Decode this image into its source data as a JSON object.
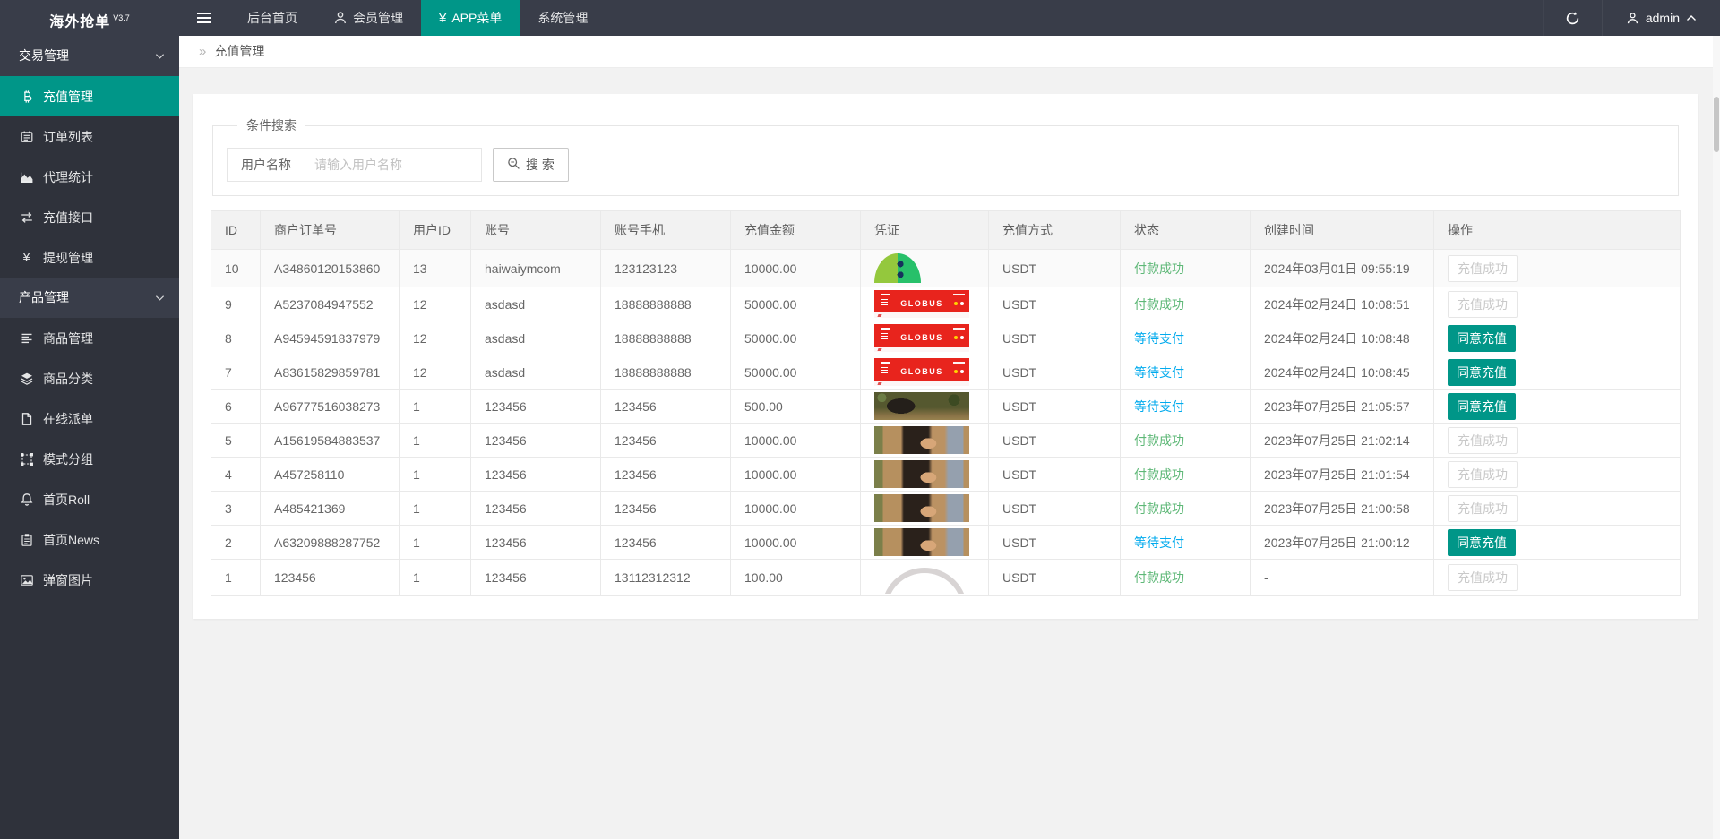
{
  "app": {
    "title": "海外抢单",
    "version": "V3.7"
  },
  "topbar": {
    "nav": [
      {
        "key": "dashboard",
        "label": "后台首页"
      },
      {
        "key": "members",
        "label": "会员管理",
        "icon": "user-icon"
      },
      {
        "key": "app-menu",
        "label": "APP菜单",
        "icon": "yen-icon",
        "active": true
      },
      {
        "key": "system",
        "label": "系统管理"
      }
    ],
    "username": "admin"
  },
  "sidebar": {
    "items": [
      {
        "type": "group",
        "key": "trade-manage",
        "label": "交易管理"
      },
      {
        "type": "item",
        "key": "recharge-manage",
        "label": "充值管理",
        "icon": "bitcoin-icon",
        "active": true
      },
      {
        "type": "item",
        "key": "order-list",
        "label": "订单列表",
        "icon": "order-list-icon"
      },
      {
        "type": "item",
        "key": "agent-stats",
        "label": "代理统计",
        "icon": "chart-area-icon"
      },
      {
        "type": "item",
        "key": "recharge-api",
        "label": "充值接口",
        "icon": "exchange-icon"
      },
      {
        "type": "item",
        "key": "withdraw-manage",
        "label": "提现管理",
        "icon": "yen-icon"
      },
      {
        "type": "group",
        "key": "product-manage",
        "label": "产品管理"
      },
      {
        "type": "item",
        "key": "goods-manage",
        "label": "商品管理",
        "icon": "list-icon"
      },
      {
        "type": "item",
        "key": "goods-category",
        "label": "商品分类",
        "icon": "layers-icon"
      },
      {
        "type": "item",
        "key": "online-dispatch",
        "label": "在线派单",
        "icon": "file-icon"
      },
      {
        "type": "item",
        "key": "mode-group",
        "label": "模式分组",
        "icon": "object-group-icon"
      },
      {
        "type": "item",
        "key": "home-roll",
        "label": "首页Roll",
        "icon": "bell-icon"
      },
      {
        "type": "item",
        "key": "home-news",
        "label": "首页News",
        "icon": "clipboard-icon"
      },
      {
        "type": "item",
        "key": "popup-image",
        "label": "弹窗图片",
        "icon": "image-icon"
      }
    ]
  },
  "breadcrumb": {
    "separator": "»",
    "label": "充值管理"
  },
  "search": {
    "legend": "条件搜索",
    "field_label": "用户名称",
    "placeholder": "请输入用户名称",
    "button_label": "搜 索"
  },
  "table": {
    "columns": [
      "ID",
      "商户订单号",
      "用户ID",
      "账号",
      "账号手机",
      "充值金额",
      "凭证",
      "充值方式",
      "状态",
      "创建时间",
      "操作"
    ],
    "status_labels": {
      "success": "付款成功",
      "pending": "等待支付"
    },
    "action_labels": {
      "disabled": "充值成功",
      "primary": "同意充值"
    },
    "voucher_text": {
      "globus": "GLOBUS"
    },
    "rows": [
      {
        "id": "10",
        "order_no": "A34860120153860",
        "user_id": "13",
        "account": "haiwaiymcom",
        "phone": "123123123",
        "amount": "10000.00",
        "voucher": "green-pie",
        "method": "USDT",
        "status": "success",
        "created": "2024年03月01日 09:55:19",
        "action": "disabled"
      },
      {
        "id": "9",
        "order_no": "A5237084947552",
        "user_id": "12",
        "account": "asdasd",
        "phone": "18888888888",
        "amount": "50000.00",
        "voucher": "globus",
        "method": "USDT",
        "status": "success",
        "created": "2024年02月24日 10:08:51",
        "action": "disabled"
      },
      {
        "id": "8",
        "order_no": "A94594591837979",
        "user_id": "12",
        "account": "asdasd",
        "phone": "18888888888",
        "amount": "50000.00",
        "voucher": "globus",
        "method": "USDT",
        "status": "pending",
        "created": "2024年02月24日 10:08:48",
        "action": "primary"
      },
      {
        "id": "7",
        "order_no": "A83615829859781",
        "user_id": "12",
        "account": "asdasd",
        "phone": "18888888888",
        "amount": "50000.00",
        "voucher": "globus",
        "method": "USDT",
        "status": "pending",
        "created": "2024年02月24日 10:08:45",
        "action": "primary"
      },
      {
        "id": "6",
        "order_no": "A96777516038273",
        "user_id": "1",
        "account": "123456",
        "phone": "123456",
        "amount": "500.00",
        "voucher": "photo-trees",
        "method": "USDT",
        "status": "pending",
        "created": "2023年07月25日 21:05:57",
        "action": "primary"
      },
      {
        "id": "5",
        "order_no": "A15619584883537",
        "user_id": "1",
        "account": "123456",
        "phone": "123456",
        "amount": "10000.00",
        "voucher": "photo-girl",
        "method": "USDT",
        "status": "success",
        "created": "2023年07月25日 21:02:14",
        "action": "disabled"
      },
      {
        "id": "4",
        "order_no": "A457258110",
        "user_id": "1",
        "account": "123456",
        "phone": "123456",
        "amount": "10000.00",
        "voucher": "photo-girl",
        "method": "USDT",
        "status": "success",
        "created": "2023年07月25日 21:01:54",
        "action": "disabled"
      },
      {
        "id": "3",
        "order_no": "A485421369",
        "user_id": "1",
        "account": "123456",
        "phone": "123456",
        "amount": "10000.00",
        "voucher": "photo-girl",
        "method": "USDT",
        "status": "success",
        "created": "2023年07月25日 21:00:58",
        "action": "disabled"
      },
      {
        "id": "2",
        "order_no": "A63209888287752",
        "user_id": "1",
        "account": "123456",
        "phone": "123456",
        "amount": "10000.00",
        "voucher": "photo-girl",
        "method": "USDT",
        "status": "pending",
        "created": "2023年07月25日 21:00:12",
        "action": "primary"
      },
      {
        "id": "1",
        "order_no": "123456",
        "user_id": "1",
        "account": "123456",
        "phone": "13112312312",
        "amount": "100.00",
        "voucher": "arc",
        "method": "USDT",
        "status": "success",
        "created": "-",
        "action": "disabled"
      }
    ]
  },
  "colors": {
    "accent": "#009688",
    "success": "#5FB878",
    "pending": "#01AAED",
    "topbar": "#393D49",
    "sidebar": "#2F323B"
  }
}
